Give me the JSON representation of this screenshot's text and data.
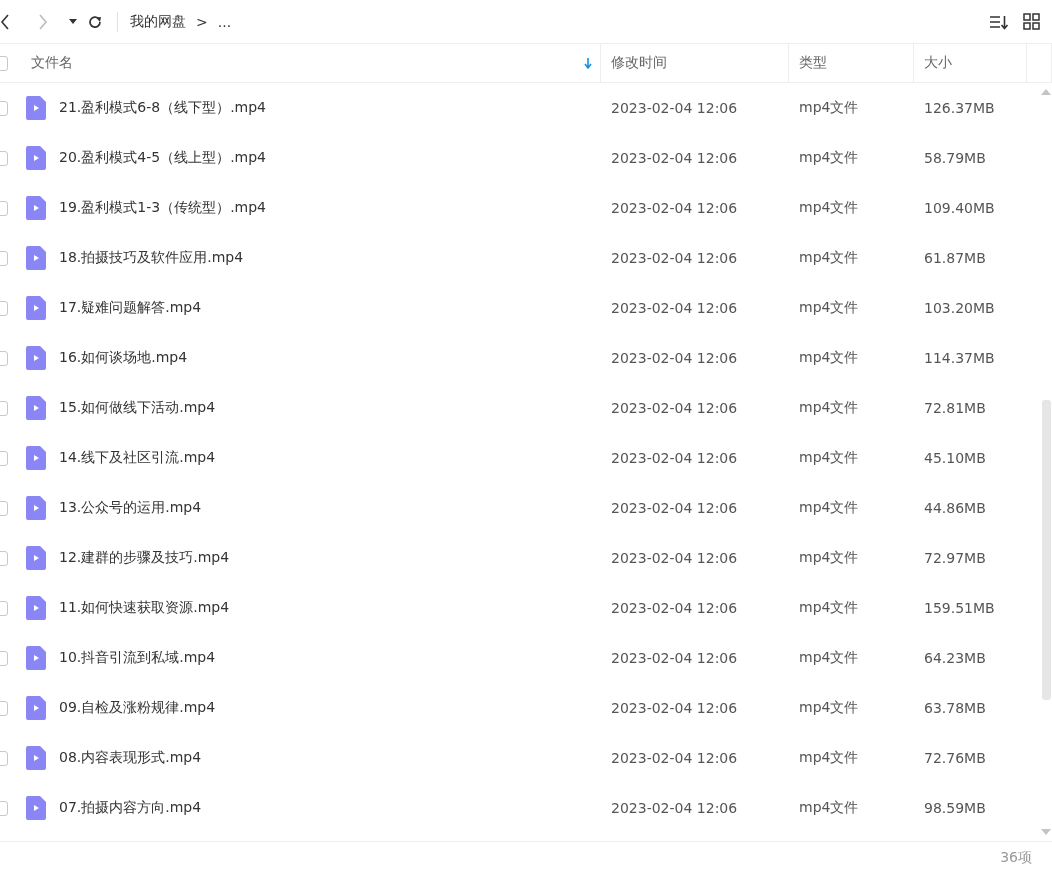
{
  "toolbar": {
    "breadcrumb": [
      {
        "label": "我的网盘"
      },
      {
        "label": "..."
      }
    ],
    "separator": ">"
  },
  "table": {
    "select_all": {
      "checked": false
    },
    "columns": [
      {
        "label": "文件名",
        "sorted": true
      },
      {
        "label": "修改时间",
        "sorted": false
      },
      {
        "label": "类型",
        "sorted": false
      },
      {
        "label": "大小",
        "sorted": false
      }
    ],
    "rows": [
      {
        "checked": false,
        "name": "21.盈利模式6-8（线下型）.mp4",
        "modified": "2023-02-04 12:06",
        "type": "mp4文件",
        "size": "126.37MB"
      },
      {
        "checked": false,
        "name": "20.盈利模式4-5（线上型）.mp4",
        "modified": "2023-02-04 12:06",
        "type": "mp4文件",
        "size": "58.79MB"
      },
      {
        "checked": false,
        "name": "19.盈利模式1-3（传统型）.mp4",
        "modified": "2023-02-04 12:06",
        "type": "mp4文件",
        "size": "109.40MB"
      },
      {
        "checked": false,
        "name": "18.拍摄技巧及软件应用.mp4",
        "modified": "2023-02-04 12:06",
        "type": "mp4文件",
        "size": "61.87MB"
      },
      {
        "checked": false,
        "name": "17.疑难问题解答.mp4",
        "modified": "2023-02-04 12:06",
        "type": "mp4文件",
        "size": "103.20MB"
      },
      {
        "checked": false,
        "name": "16.如何谈场地.mp4",
        "modified": "2023-02-04 12:06",
        "type": "mp4文件",
        "size": "114.37MB"
      },
      {
        "checked": false,
        "name": "15.如何做线下活动.mp4",
        "modified": "2023-02-04 12:06",
        "type": "mp4文件",
        "size": "72.81MB"
      },
      {
        "checked": false,
        "name": "14.线下及社区引流.mp4",
        "modified": "2023-02-04 12:06",
        "type": "mp4文件",
        "size": "45.10MB"
      },
      {
        "checked": false,
        "name": "13.公众号的运用.mp4",
        "modified": "2023-02-04 12:06",
        "type": "mp4文件",
        "size": "44.86MB"
      },
      {
        "checked": false,
        "name": "12.建群的步骤及技巧.mp4",
        "modified": "2023-02-04 12:06",
        "type": "mp4文件",
        "size": "72.97MB"
      },
      {
        "checked": false,
        "name": "11.如何快速获取资源.mp4",
        "modified": "2023-02-04 12:06",
        "type": "mp4文件",
        "size": "159.51MB"
      },
      {
        "checked": false,
        "name": "10.抖音引流到私域.mp4",
        "modified": "2023-02-04 12:06",
        "type": "mp4文件",
        "size": "64.23MB"
      },
      {
        "checked": false,
        "name": "09.自检及涨粉规律.mp4",
        "modified": "2023-02-04 12:06",
        "type": "mp4文件",
        "size": "63.78MB"
      },
      {
        "checked": false,
        "name": "08.内容表现形式.mp4",
        "modified": "2023-02-04 12:06",
        "type": "mp4文件",
        "size": "72.76MB"
      },
      {
        "checked": false,
        "name": "07.拍摄内容方向.mp4",
        "modified": "2023-02-04 12:06",
        "type": "mp4文件",
        "size": "98.59MB"
      }
    ]
  },
  "status_bar": {
    "count": "36项"
  }
}
